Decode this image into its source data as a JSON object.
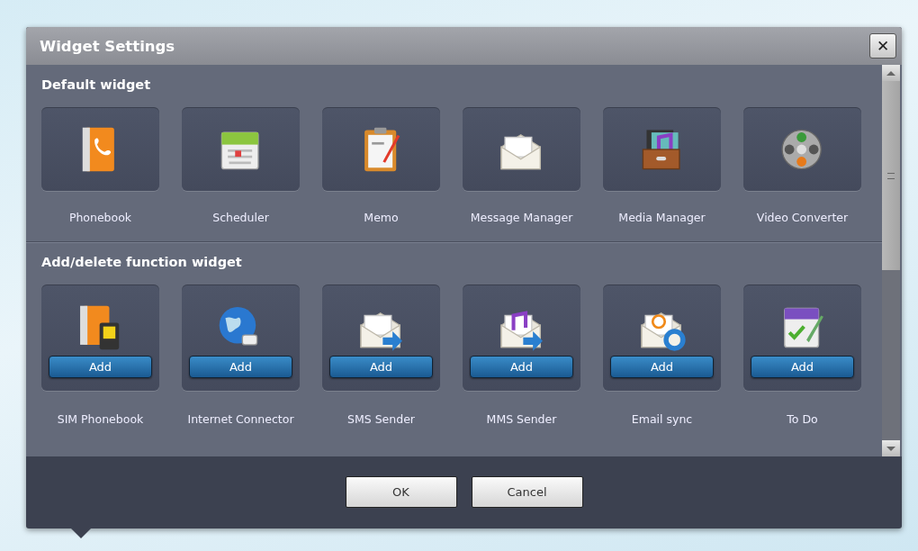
{
  "window": {
    "title": "Widget Settings",
    "close": "✕"
  },
  "sections": [
    {
      "title": "Default widget",
      "widgets": [
        {
          "label": "Phonebook",
          "kind": "phonebook"
        },
        {
          "label": "Scheduler",
          "kind": "calendar"
        },
        {
          "label": "Memo",
          "kind": "memo"
        },
        {
          "label": "Message Manager",
          "kind": "envelope"
        },
        {
          "label": "Media Manager",
          "kind": "mediabox"
        },
        {
          "label": "Video Converter",
          "kind": "reel"
        }
      ]
    },
    {
      "title": "Add/delete function widget",
      "widgets": [
        {
          "label": "SIM Phonebook",
          "kind": "simbook",
          "button": "Add"
        },
        {
          "label": "Internet Connector",
          "kind": "globe",
          "button": "Add"
        },
        {
          "label": "SMS Sender",
          "kind": "envsend",
          "button": "Add"
        },
        {
          "label": "MMS Sender",
          "kind": "envmusic",
          "button": "Add"
        },
        {
          "label": "Email sync",
          "kind": "envsync",
          "button": "Add"
        },
        {
          "label": "To Do",
          "kind": "todo",
          "button": "Add"
        }
      ]
    }
  ],
  "buttons": [
    "OK",
    "Cancel"
  ]
}
